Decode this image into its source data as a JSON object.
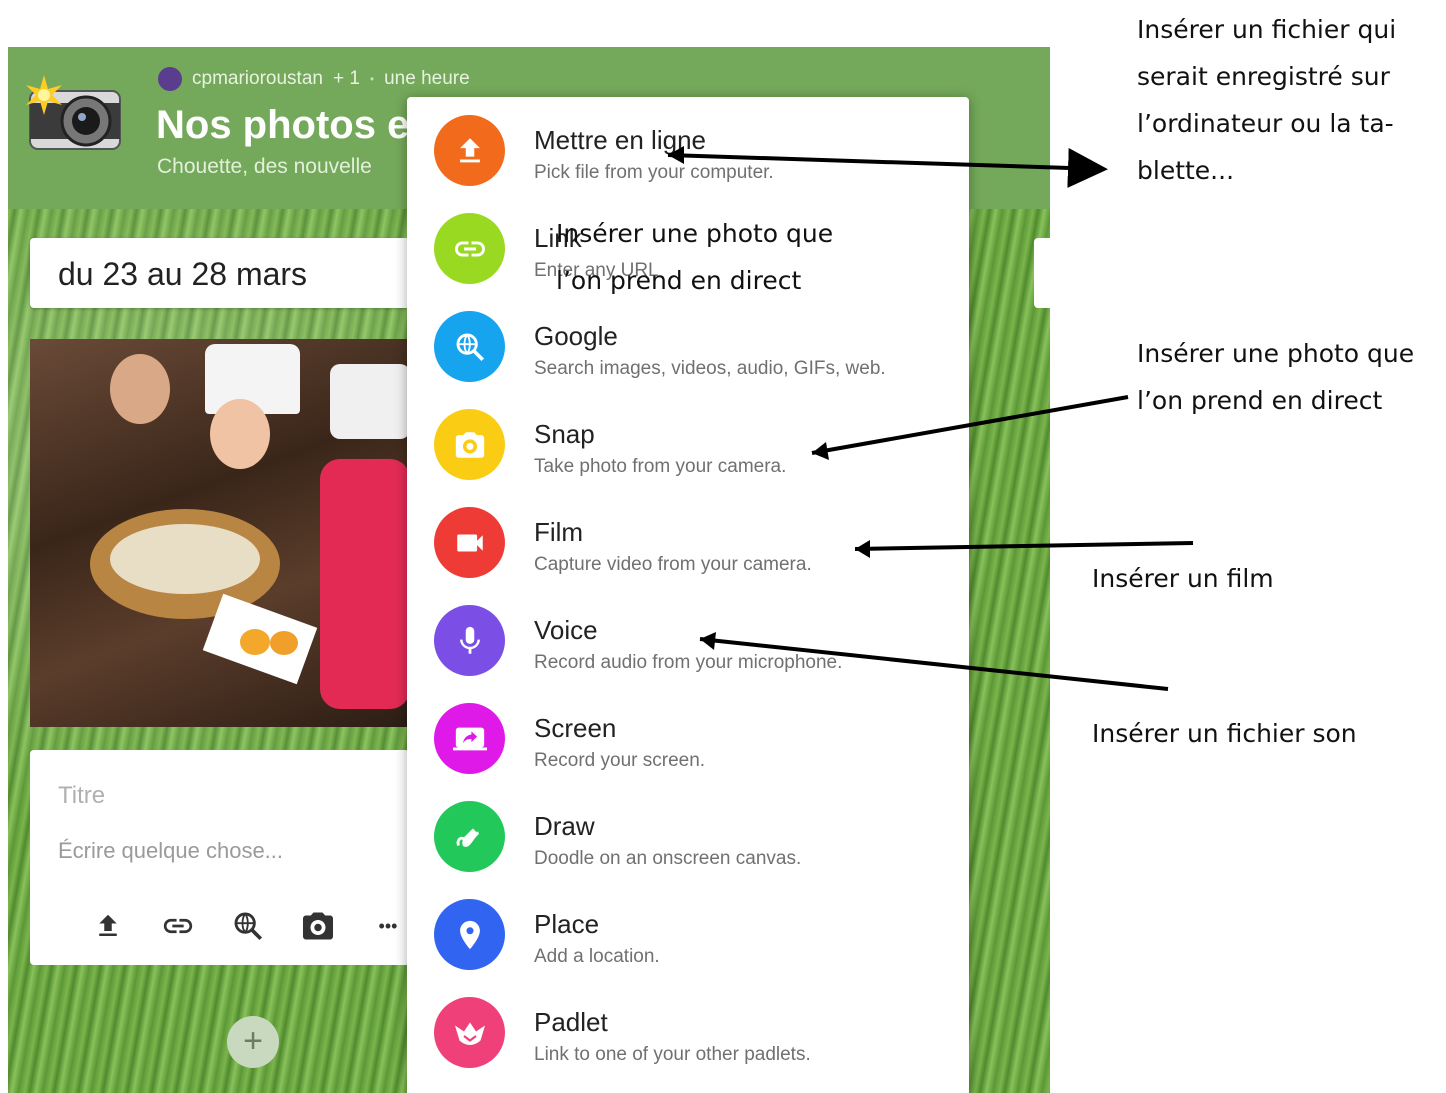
{
  "header": {
    "username": "cpmarioroustan",
    "plus_count": "+ 1",
    "separator": "•",
    "time": "une heure",
    "title": "Nos photos e",
    "subtitle": "Chouette, des nouvelle"
  },
  "column": {
    "title": "du 23 au 28 mars"
  },
  "composer": {
    "title_placeholder": "Titre",
    "body_placeholder": "Écrire quelque chose...",
    "more": "•••"
  },
  "add_button": "+",
  "menu": {
    "items": [
      {
        "label": "Mettre en ligne",
        "desc": "Pick file from your computer.",
        "color": "#f26b1d",
        "icon": "upload-icon"
      },
      {
        "label": "Link",
        "desc": "Enter any URL",
        "color": "#9ad921",
        "icon": "link-icon"
      },
      {
        "label": "Google",
        "desc": "Search images, videos, audio, GIFs, web.",
        "color": "#16a4ef",
        "icon": "web-search-icon"
      },
      {
        "label": "Snap",
        "desc": "Take photo from your camera.",
        "color": "#fbcc14",
        "icon": "camera-icon"
      },
      {
        "label": "Film",
        "desc": "Capture video from your camera.",
        "color": "#ee3b35",
        "icon": "video-camera-icon"
      },
      {
        "label": "Voice",
        "desc": "Record audio from your microphone.",
        "color": "#7b4fe6",
        "icon": "microphone-icon"
      },
      {
        "label": "Screen",
        "desc": "Record your screen.",
        "color": "#df19e8",
        "icon": "screen-share-icon"
      },
      {
        "label": "Draw",
        "desc": "Doodle on an onscreen canvas.",
        "color": "#23c85a",
        "icon": "draw-icon"
      },
      {
        "label": "Place",
        "desc": "Add a location.",
        "color": "#3164f1",
        "icon": "location-pin-icon"
      },
      {
        "label": "Padlet",
        "desc": "Link to one of your other padlets.",
        "color": "#f0407a",
        "icon": "padlet-bird-icon"
      }
    ]
  },
  "annotations": {
    "note1": [
      "Insérer un fichier qui",
      "serait enregistré sur",
      "l’ordinateur ou la ta-",
      "blette..."
    ],
    "note2": [
      "Insérer une photo que",
      "l’on prend en direct"
    ],
    "note3": [
      "Insérer une photo que",
      "l’on prend en direct"
    ],
    "note4": "Insérer un film",
    "note5": "Insérer un fichier son"
  }
}
